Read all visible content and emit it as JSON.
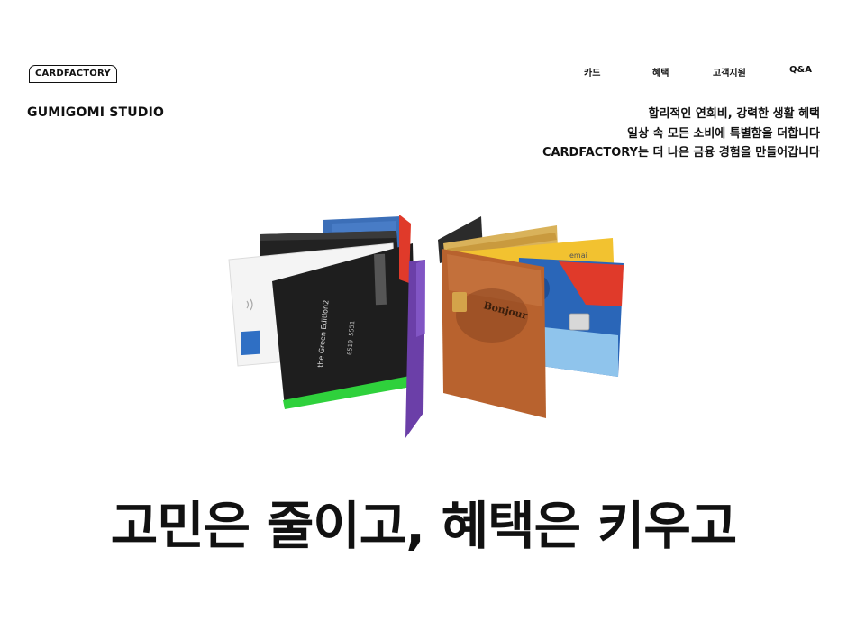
{
  "header": {
    "logo": "CARDFACTORY",
    "nav": [
      {
        "label": "카드"
      },
      {
        "label": "혜택"
      },
      {
        "label": "고객지원"
      },
      {
        "label": "Q&A"
      }
    ]
  },
  "studio_name": "GUMIGOMI STUDIO",
  "tagline": [
    "합리적인 연회비, 강력한 생활 혜택",
    "일상 속 모든 소비에 특별함을 더합니다",
    "CARDFACTORY는 더 나은 금융 경험을 만들어갑니다"
  ],
  "card_texts": {
    "green_edition": "the Green Edition2",
    "wooden_brand": "Bonjour",
    "top_strip": "emai"
  },
  "hero_heading": "고민은 줄이고, 혜택은 키우고",
  "colors": {
    "background": "#ffffff",
    "text": "#111111",
    "card_black": "#1e1e1e",
    "card_green_stripe": "#2fd13c",
    "card_purple": "#6b3fa8",
    "card_copper": "#b8622e",
    "card_blue": "#2a66b8",
    "card_red": "#e03a2a",
    "card_yellow": "#f2c230"
  }
}
